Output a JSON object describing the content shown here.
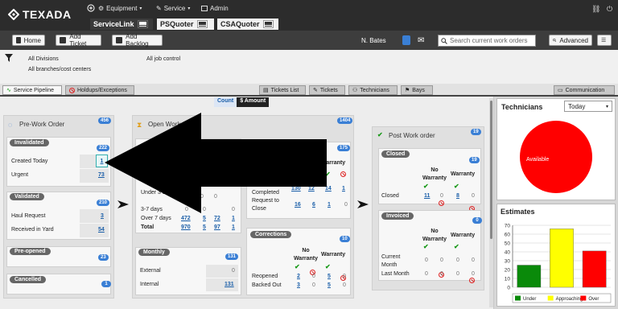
{
  "app": {
    "logo": "TEXADA"
  },
  "nav": {
    "equipment": "Equipment",
    "service": "Service",
    "admin": "Admin",
    "apps": [
      "ServiceLink",
      "PSQuoter",
      "CSAQuoter"
    ]
  },
  "toolbar": {
    "home": "Home",
    "add_ticket": "Add Ticket",
    "add_backlog": "Add Backlog",
    "user": "N. Bates",
    "search_placeholder": "Search current work orders",
    "advanced": "Advanced"
  },
  "filters": {
    "divisions": "All Divisions",
    "branches": "All branches/cost centers",
    "job_control": "All job control"
  },
  "tabs": {
    "service_pipeline": "Service Pipeline",
    "holdups": "Holdups/Exceptions",
    "tickets_list": "Tickets List",
    "tickets": "Tickets",
    "technicians": "Technicians",
    "bays": "Bays",
    "communication": "Communication"
  },
  "toggle": {
    "count": "Count",
    "amount": "$ Amount"
  },
  "pre_work": {
    "title": "Pre-Work Order",
    "badge": "456",
    "invalidated": {
      "label": "Invalidated",
      "badge": "222",
      "created_today_label": "Created Today",
      "created_today": "1",
      "urgent_label": "Urgent",
      "urgent": "73"
    },
    "validated": {
      "label": "Validated",
      "badge": "210",
      "haul_label": "Haul Request",
      "haul": "3",
      "received_label": "Received in Yard",
      "received": "54"
    },
    "preopened": {
      "label": "Pre-opened",
      "badge": "23"
    },
    "cancelled": {
      "label": "Cancelled",
      "badge": "1"
    }
  },
  "open_work": {
    "title": "Open Work Order",
    "badge": "1404",
    "aging": {
      "rows": [
        {
          "label": "Under 3 Days",
          "v1": "0",
          "v2": "0",
          "v3": "0"
        },
        {
          "label": "3-7 days",
          "v1": "0",
          "v2": "0",
          "v3": "0"
        },
        {
          "label": "Over 7 days",
          "v1": "472",
          "v2": "5",
          "v3": "72",
          "v4": "1"
        },
        {
          "label": "Total",
          "v1": "970",
          "v2": "5",
          "v3": "97",
          "v4": "1"
        }
      ]
    },
    "completed": {
      "badge": "175",
      "warranty": "Warranty",
      "label": "Completed Request to Close",
      "v1": "130",
      "v2": "12",
      "v3": "14",
      "v4": "1",
      "v5": "16",
      "v6": "6",
      "v7": "1",
      "v8": "0"
    },
    "monthly": {
      "label": "Monthly",
      "badge": "131",
      "external_label": "External",
      "external": "0",
      "internal_label": "Internal",
      "internal": "131"
    },
    "corrections": {
      "label": "Corrections",
      "badge": "10",
      "no_warranty": "No Warranty",
      "warranty": "Warranty",
      "reopened_label": "Reopened",
      "reopened": [
        "2",
        "0",
        "5",
        "0"
      ],
      "backed_label": "Backed Out",
      "backed": [
        "3",
        "0",
        "5",
        "0"
      ]
    }
  },
  "post_work": {
    "title": "Post Work order",
    "badge": "19",
    "closed": {
      "label": "Closed",
      "badge": "19",
      "no_warranty": "No Warranty",
      "warranty": "Warranty",
      "row_label": "Closed",
      "values": [
        "11",
        "0",
        "8",
        "0"
      ]
    },
    "invoiced": {
      "label": "Invoiced",
      "badge": "0",
      "no_warranty": "No Warranty",
      "warranty": "Warranty",
      "current_label": "Current Month",
      "current": [
        "0",
        "0",
        "0",
        "0"
      ],
      "last_label": "Last Month",
      "last": [
        "0",
        "0",
        "0",
        "0"
      ]
    }
  },
  "technicians": {
    "title": "Technicians",
    "range": "Today",
    "pie_label": "Available",
    "pie_color": "#ff0000"
  },
  "chart_data": {
    "type": "bar",
    "title": "Estimates",
    "categories": [
      "Under",
      "Approaching",
      "Over"
    ],
    "values": [
      25,
      66,
      41
    ],
    "colors": [
      "#0a8a0a",
      "#ffff00",
      "#ff0000"
    ],
    "ylim": [
      0,
      70
    ],
    "yticks": [
      "0",
      "10",
      "20",
      "30",
      "40",
      "50",
      "60",
      "70"
    ],
    "legend": [
      "Under",
      "Approaching",
      "Over"
    ],
    "legend_position": "bottom"
  }
}
